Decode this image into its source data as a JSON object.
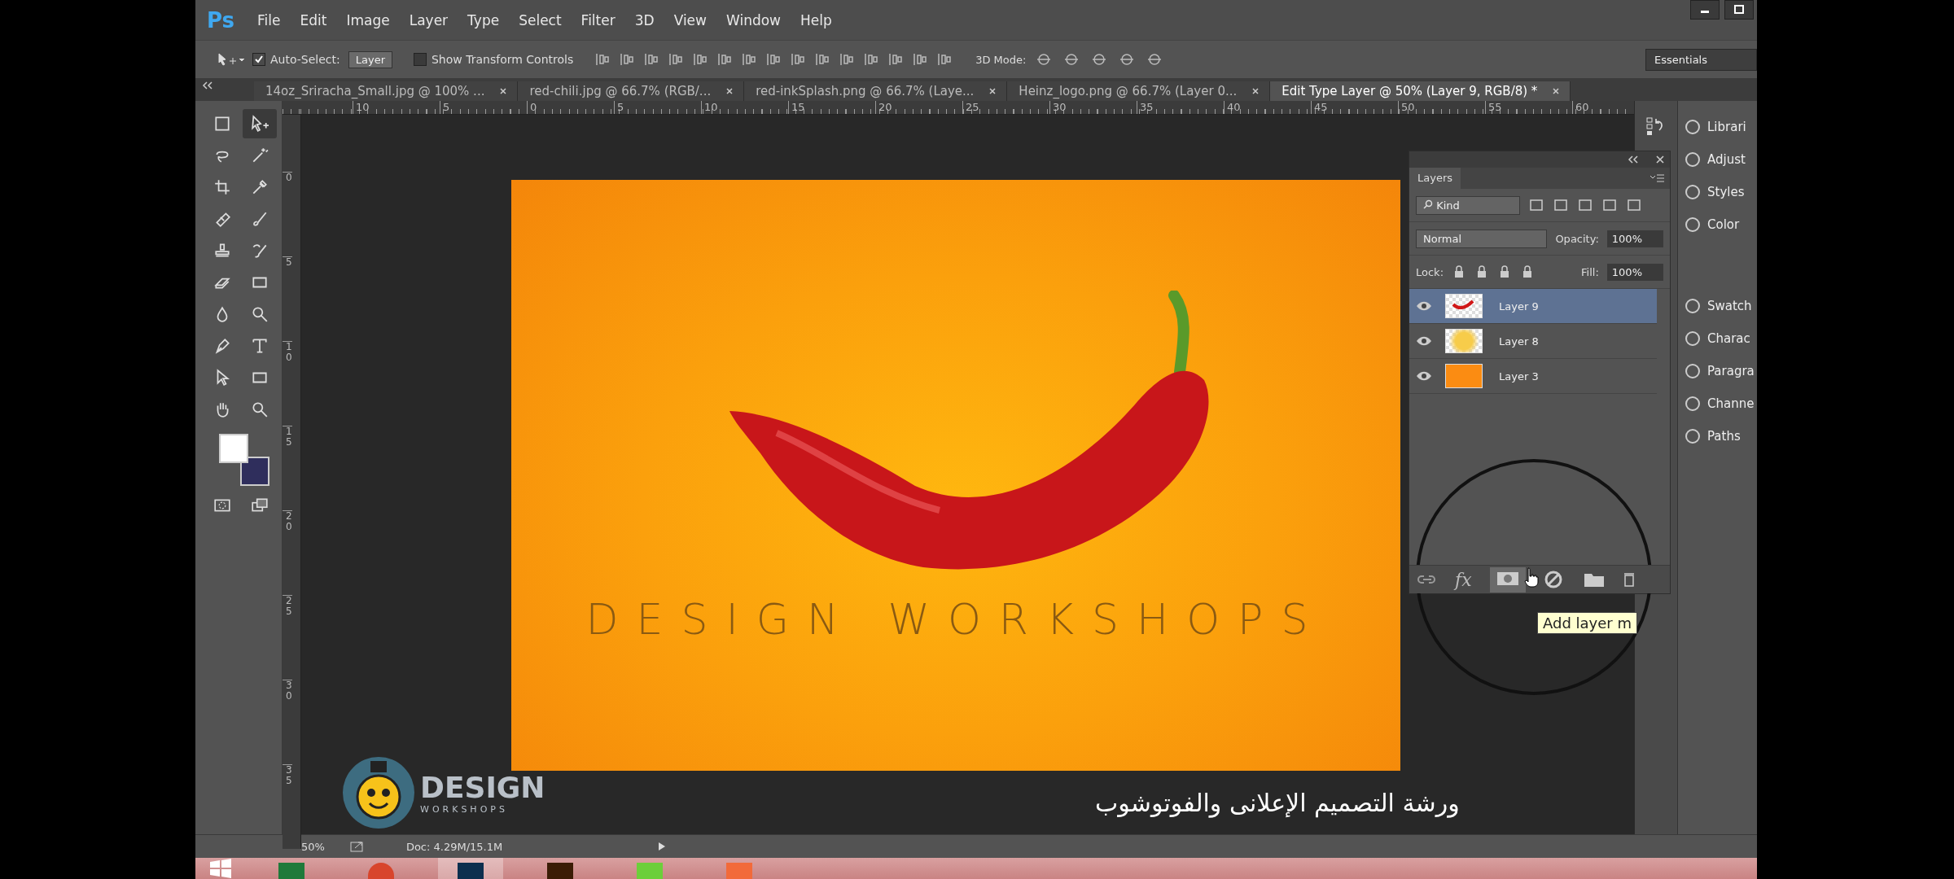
{
  "app": {
    "logo": "Ps"
  },
  "menu": [
    "File",
    "Edit",
    "Image",
    "Layer",
    "Type",
    "Select",
    "Filter",
    "3D",
    "View",
    "Window",
    "Help"
  ],
  "options_bar": {
    "auto_select": {
      "label": "Auto-Select:",
      "checked": true
    },
    "target": "Layer",
    "transform_controls": {
      "label": "Show Transform Controls",
      "checked": false
    },
    "mode_label": "3D Mode:",
    "workspace": "Essentials"
  },
  "tabs": [
    {
      "label": "14oz_Sriracha_Small.jpg @ 100% ...",
      "selected": false
    },
    {
      "label": "red-chili.jpg @ 66.7% (RGB/...",
      "selected": false
    },
    {
      "label": "red-inkSplash.png @ 66.7% (Laye...",
      "selected": false
    },
    {
      "label": "Heinz_logo.png @ 66.7% (Layer 0...",
      "selected": false
    },
    {
      "label": "Edit Type Layer @ 50% (Layer 9, RGB/8) *",
      "selected": true
    }
  ],
  "tools": [
    {
      "kind": "marquee",
      "selected": false
    },
    {
      "kind": "move",
      "selected": true
    },
    {
      "kind": "lasso",
      "selected": false
    },
    {
      "kind": "wand",
      "selected": false
    },
    {
      "kind": "crop",
      "selected": false
    },
    {
      "kind": "eyedropper",
      "selected": false
    },
    {
      "kind": "healing",
      "selected": false
    },
    {
      "kind": "brush",
      "selected": false
    },
    {
      "kind": "stamp",
      "selected": false
    },
    {
      "kind": "history",
      "selected": false
    },
    {
      "kind": "eraser",
      "selected": false
    },
    {
      "kind": "gradient",
      "selected": false
    },
    {
      "kind": "blur",
      "selected": false
    },
    {
      "kind": "dodge",
      "selected": false
    },
    {
      "kind": "pen",
      "selected": false
    },
    {
      "kind": "type",
      "selected": false
    },
    {
      "kind": "select",
      "selected": false
    },
    {
      "kind": "shape",
      "selected": false
    },
    {
      "kind": "hand",
      "selected": false
    },
    {
      "kind": "zoom",
      "selected": false
    }
  ],
  "swatches": [
    {
      "kind": "foreground",
      "color": "#ffffff"
    },
    {
      "kind": "background",
      "color": "#2f2e5c"
    }
  ],
  "rulers": {
    "horizontal": [
      "10",
      "5",
      "0",
      "5",
      "10",
      "15",
      "20",
      "25",
      "30",
      "35",
      "40",
      "45",
      "50",
      "55",
      "60"
    ],
    "vertical": [
      "0",
      "5",
      "10",
      "15",
      "20",
      "25",
      "30",
      "35"
    ]
  },
  "canvas": {
    "headline": "DESIGN WORKSHOPS"
  },
  "layers_panel": {
    "title": "Layers",
    "filter": "Kind",
    "blend_mode": "Normal",
    "opacity_label": "Opacity:",
    "opacity": "100%",
    "lock_label": "Lock:",
    "fill_label": "Fill:",
    "fill": "100%",
    "layers": [
      {
        "name": "Layer 9",
        "selected": true,
        "visible": true,
        "kind": "chili"
      },
      {
        "name": "Layer 8",
        "selected": false,
        "visible": true,
        "kind": "glow"
      },
      {
        "name": "Layer 3",
        "selected": false,
        "visible": true,
        "kind": "solid"
      }
    ],
    "fx_label": "fx",
    "tooltip": "Add layer m"
  },
  "dock": [
    {
      "label": "Librari"
    },
    {
      "label": "Adjust"
    },
    {
      "label": "Styles"
    },
    {
      "label": "Color"
    },
    {
      "label": "Swatch"
    },
    {
      "label": "Charac"
    },
    {
      "label": "Paragra"
    },
    {
      "label": "Channe"
    },
    {
      "label": "Paths"
    }
  ],
  "status_bar": {
    "zoom": "50%",
    "doc": "Doc: 4.29M/15.1M"
  },
  "video_overlay": {
    "logo_title": "DESIGN",
    "logo_subtitle": "WORKSHOPS",
    "caption": "ورشة التصميم الإعلانى  والفوتوشوب"
  }
}
